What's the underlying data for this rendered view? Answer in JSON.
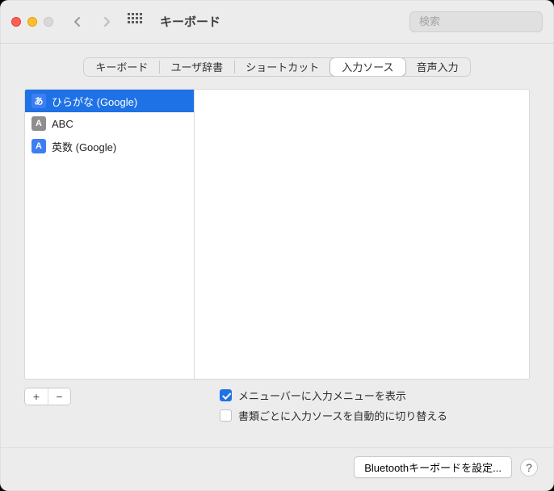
{
  "colors": {
    "accent": "#1f72e5"
  },
  "window": {
    "title": "キーボード"
  },
  "search": {
    "placeholder": "検索"
  },
  "tabs": [
    {
      "label": "キーボード",
      "active": false
    },
    {
      "label": "ユーザ辞書",
      "active": false
    },
    {
      "label": "ショートカット",
      "active": false
    },
    {
      "label": "入力ソース",
      "active": true
    },
    {
      "label": "音声入力",
      "active": false
    }
  ],
  "sources": [
    {
      "badge": "あ",
      "badgeStyle": "blue",
      "label": "ひらがな (Google)",
      "selected": true
    },
    {
      "badge": "A",
      "badgeStyle": "grey",
      "label": "ABC",
      "selected": false
    },
    {
      "badge": "A",
      "badgeStyle": "blue",
      "label": "英数 (Google)",
      "selected": false
    }
  ],
  "addRemove": {
    "add": "+",
    "remove": "−"
  },
  "checkboxes": [
    {
      "label": "メニューバーに入力メニューを表示",
      "checked": true
    },
    {
      "label": "書類ごとに入力ソースを自動的に切り替える",
      "checked": false
    }
  ],
  "footer": {
    "bluetooth": "Bluetoothキーボードを設定...",
    "help": "?"
  }
}
